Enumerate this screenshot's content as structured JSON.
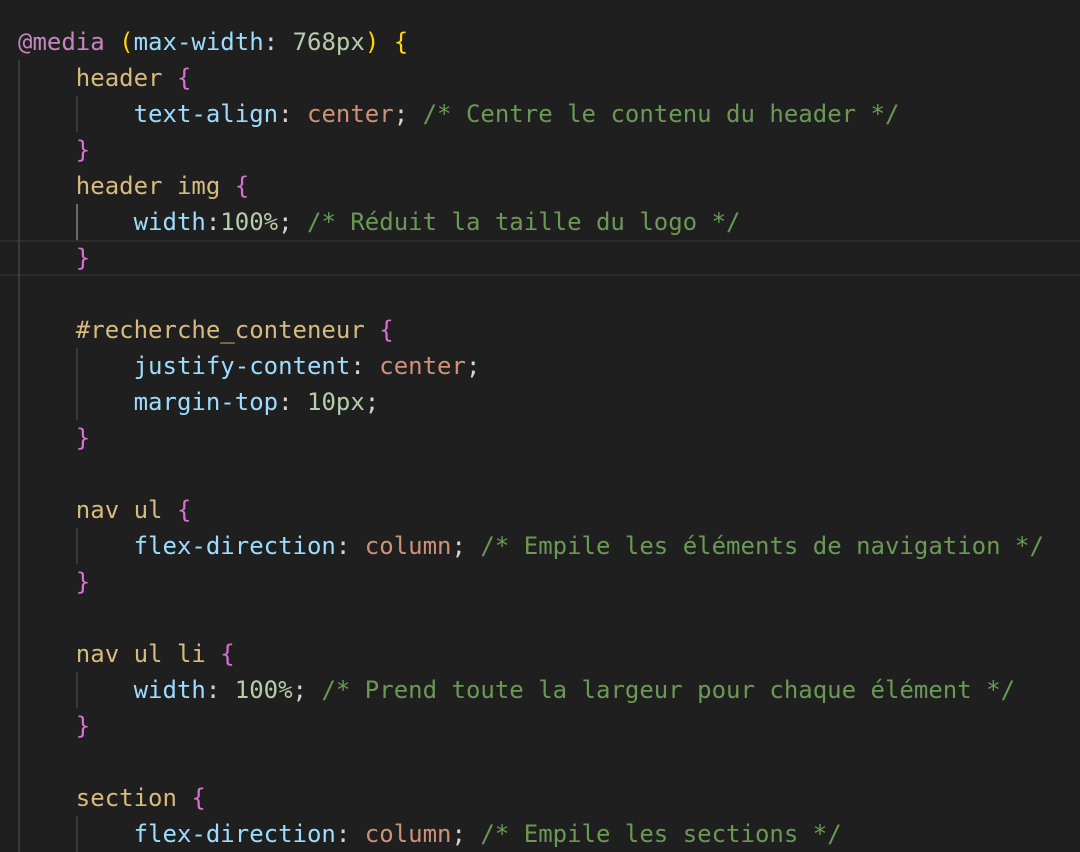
{
  "colors": {
    "background": "#1f1f1f",
    "keyword": "#c586c0",
    "bracket1": "#ffd700",
    "bracket2": "#da70d6",
    "selector": "#d7ba7d",
    "property": "#9cdcfe",
    "value": "#ce9178",
    "number": "#b5cea8",
    "comment": "#6a9955",
    "punct": "#d4d4d4"
  },
  "current_line": 6,
  "lines": [
    {
      "indent": 0,
      "tokens": [
        {
          "t": "@media",
          "c": "keyword"
        },
        {
          "t": " ",
          "c": "punct"
        },
        {
          "t": "(",
          "c": "bracket1"
        },
        {
          "t": "max-width",
          "c": "property"
        },
        {
          "t": ": ",
          "c": "punct"
        },
        {
          "t": "768px",
          "c": "number"
        },
        {
          "t": ")",
          "c": "bracket1"
        },
        {
          "t": " ",
          "c": "punct"
        },
        {
          "t": "{",
          "c": "bracket1"
        }
      ]
    },
    {
      "indent": 1,
      "tokens": [
        {
          "t": "header",
          "c": "selector"
        },
        {
          "t": " ",
          "c": "punct"
        },
        {
          "t": "{",
          "c": "bracket2"
        }
      ]
    },
    {
      "indent": 2,
      "tokens": [
        {
          "t": "text-align",
          "c": "property"
        },
        {
          "t": ": ",
          "c": "punct"
        },
        {
          "t": "center",
          "c": "value"
        },
        {
          "t": "; ",
          "c": "punct"
        },
        {
          "t": "/* Centre le contenu du header */",
          "c": "comment"
        }
      ]
    },
    {
      "indent": 1,
      "tokens": [
        {
          "t": "}",
          "c": "bracket2"
        }
      ]
    },
    {
      "indent": 1,
      "tokens": [
        {
          "t": "header img",
          "c": "selector"
        },
        {
          "t": " ",
          "c": "punct"
        },
        {
          "t": "{",
          "c": "bracket2"
        }
      ]
    },
    {
      "indent": 2,
      "tokens": [
        {
          "t": "width",
          "c": "property"
        },
        {
          "t": ":",
          "c": "punct"
        },
        {
          "t": "100%",
          "c": "number"
        },
        {
          "t": "; ",
          "c": "punct"
        },
        {
          "t": "/* Réduit la taille du logo */",
          "c": "comment"
        }
      ]
    },
    {
      "indent": 1,
      "tokens": [
        {
          "t": "}",
          "c": "bracket2"
        }
      ]
    },
    {
      "indent": 0,
      "tokens": []
    },
    {
      "indent": 1,
      "tokens": [
        {
          "t": "#recherche_conteneur",
          "c": "selector"
        },
        {
          "t": " ",
          "c": "punct"
        },
        {
          "t": "{",
          "c": "bracket2"
        }
      ]
    },
    {
      "indent": 2,
      "tokens": [
        {
          "t": "justify-content",
          "c": "property"
        },
        {
          "t": ": ",
          "c": "punct"
        },
        {
          "t": "center",
          "c": "value"
        },
        {
          "t": ";",
          "c": "punct"
        }
      ]
    },
    {
      "indent": 2,
      "tokens": [
        {
          "t": "margin-top",
          "c": "property"
        },
        {
          "t": ": ",
          "c": "punct"
        },
        {
          "t": "10px",
          "c": "number"
        },
        {
          "t": ";",
          "c": "punct"
        }
      ]
    },
    {
      "indent": 1,
      "tokens": [
        {
          "t": "}",
          "c": "bracket2"
        }
      ]
    },
    {
      "indent": 0,
      "tokens": []
    },
    {
      "indent": 1,
      "tokens": [
        {
          "t": "nav ul",
          "c": "selector"
        },
        {
          "t": " ",
          "c": "punct"
        },
        {
          "t": "{",
          "c": "bracket2"
        }
      ]
    },
    {
      "indent": 2,
      "tokens": [
        {
          "t": "flex-direction",
          "c": "property"
        },
        {
          "t": ": ",
          "c": "punct"
        },
        {
          "t": "column",
          "c": "value"
        },
        {
          "t": "; ",
          "c": "punct"
        },
        {
          "t": "/* Empile les éléments de navigation */",
          "c": "comment"
        }
      ]
    },
    {
      "indent": 1,
      "tokens": [
        {
          "t": "}",
          "c": "bracket2"
        }
      ]
    },
    {
      "indent": 0,
      "tokens": []
    },
    {
      "indent": 1,
      "tokens": [
        {
          "t": "nav ul li",
          "c": "selector"
        },
        {
          "t": " ",
          "c": "punct"
        },
        {
          "t": "{",
          "c": "bracket2"
        }
      ]
    },
    {
      "indent": 2,
      "tokens": [
        {
          "t": "width",
          "c": "property"
        },
        {
          "t": ": ",
          "c": "punct"
        },
        {
          "t": "100%",
          "c": "number"
        },
        {
          "t": "; ",
          "c": "punct"
        },
        {
          "t": "/* Prend toute la largeur pour chaque élément */",
          "c": "comment"
        }
      ]
    },
    {
      "indent": 1,
      "tokens": [
        {
          "t": "}",
          "c": "bracket2"
        }
      ]
    },
    {
      "indent": 0,
      "tokens": []
    },
    {
      "indent": 1,
      "tokens": [
        {
          "t": "section",
          "c": "selector"
        },
        {
          "t": " ",
          "c": "punct"
        },
        {
          "t": "{",
          "c": "bracket2"
        }
      ]
    },
    {
      "indent": 2,
      "tokens": [
        {
          "t": "flex-direction",
          "c": "property"
        },
        {
          "t": ": ",
          "c": "punct"
        },
        {
          "t": "column",
          "c": "value"
        },
        {
          "t": "; ",
          "c": "punct"
        },
        {
          "t": "/* Empile les sections */",
          "c": "comment"
        }
      ]
    }
  ]
}
